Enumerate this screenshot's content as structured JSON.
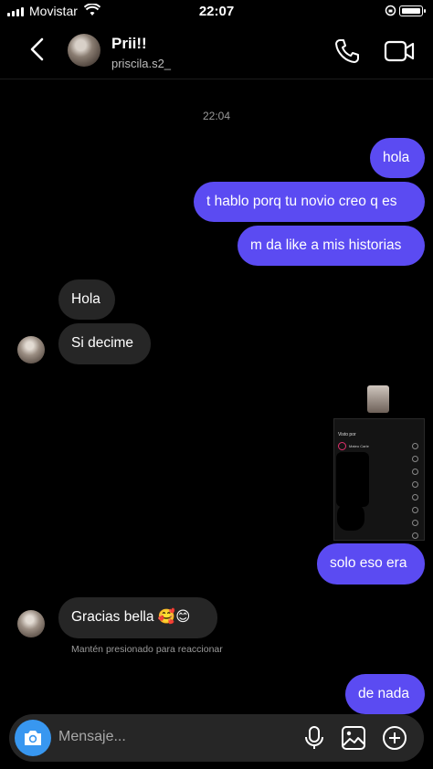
{
  "status_bar": {
    "carrier": "Movistar",
    "time": "22:07"
  },
  "header": {
    "name": "Prii!!",
    "username": "priscila.s2_"
  },
  "chat": {
    "timestamp": "22:04",
    "messages": [
      {
        "dir": "out",
        "text": "hola"
      },
      {
        "dir": "out",
        "text": "t hablo porq tu novio creo q es"
      },
      {
        "dir": "out",
        "text": "m da like a mis historias"
      },
      {
        "dir": "in",
        "text": "Hola"
      },
      {
        "dir": "in",
        "text": "Si decime"
      },
      {
        "dir": "out",
        "text": "solo eso era"
      },
      {
        "dir": "in",
        "text": "Gracias bella 🥰😊"
      },
      {
        "dir": "out",
        "text": "de nada"
      }
    ],
    "reaction_hint": "Mantén presionado para reaccionar",
    "shared_image": {
      "title": "Visto por",
      "first_viewer": "Mateo Carle"
    }
  },
  "composer": {
    "placeholder": "Mensaje..."
  },
  "colors": {
    "outgoing": "#5b4bf2",
    "incoming": "#262626",
    "camera": "#3897f0"
  }
}
